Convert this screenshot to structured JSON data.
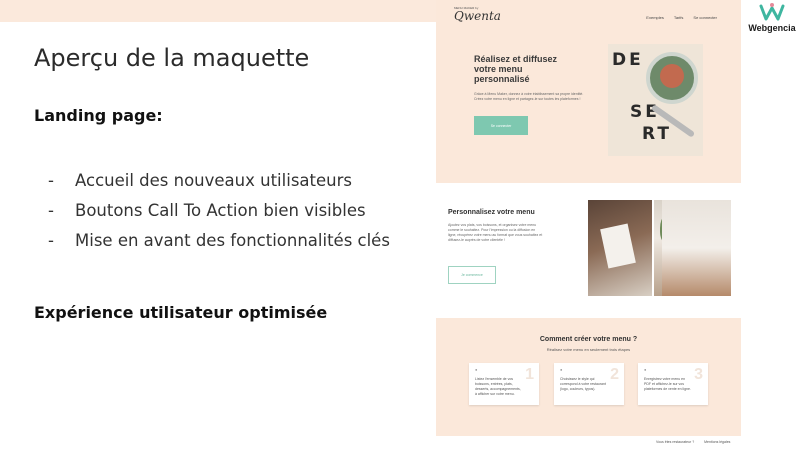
{
  "slide": {
    "title": "Aperçu de la maquette",
    "section1": "Landing page:",
    "bullets": [
      "Accueil des nouveaux utilisateurs",
      "Boutons Call To Action bien visibles",
      "Mise en avant des fonctionnalités clés"
    ],
    "section2": "Expérience utilisateur optimisée"
  },
  "logo": {
    "text": "Webgencia",
    "color": "#3fb6a0"
  },
  "mockup": {
    "brand_small": "MENU MAKER by",
    "brand": "Qwenta",
    "nav": [
      "Exemples",
      "Tarifs",
      "Se connecter"
    ],
    "hero": {
      "heading": "Réalisez et diffusez votre menu personnalisé",
      "paragraph": "Grâce à Menu Maker, donnez à votre établissement sa propre identité. Créez votre menu en ligne et partagez-le sur toutes les plateformes !",
      "cta": "Se connecter",
      "photo_letters": [
        "DE",
        "SE",
        "RT"
      ]
    },
    "section2": {
      "heading": "Personnalisez votre menu",
      "paragraph": "Ajoutez vos plats, vos boissons, et organisez votre menu comme le souhaitez. Pour l'impression ou la diffusion en ligne, récupérez votre menu au format que vous souhaitez et diffusez-le auprès de votre clientèle !",
      "button": "Je commence"
    },
    "section3": {
      "heading": "Comment créer votre menu ?",
      "subheading": "Réalisez votre menu en seulement trois étapes",
      "steps": [
        {
          "num": "1",
          "text": "Listez l'ensemble de vos boissons, entrées, plats, desserts, accompagnements, à afficher sur votre menu."
        },
        {
          "num": "2",
          "text": "Choisissez le style qui correspond à votre restaurant (logo, couleurs, typos)."
        },
        {
          "num": "3",
          "text": "Enregistrez votre menu en PDF et affichez-le sur vos plateformes de vente en ligne."
        }
      ]
    },
    "footer": [
      "Vous êtes restaurateur ?",
      "Mentions légales"
    ]
  },
  "colors": {
    "peach": "#fbe8da",
    "mint": "#7ec8b0"
  }
}
